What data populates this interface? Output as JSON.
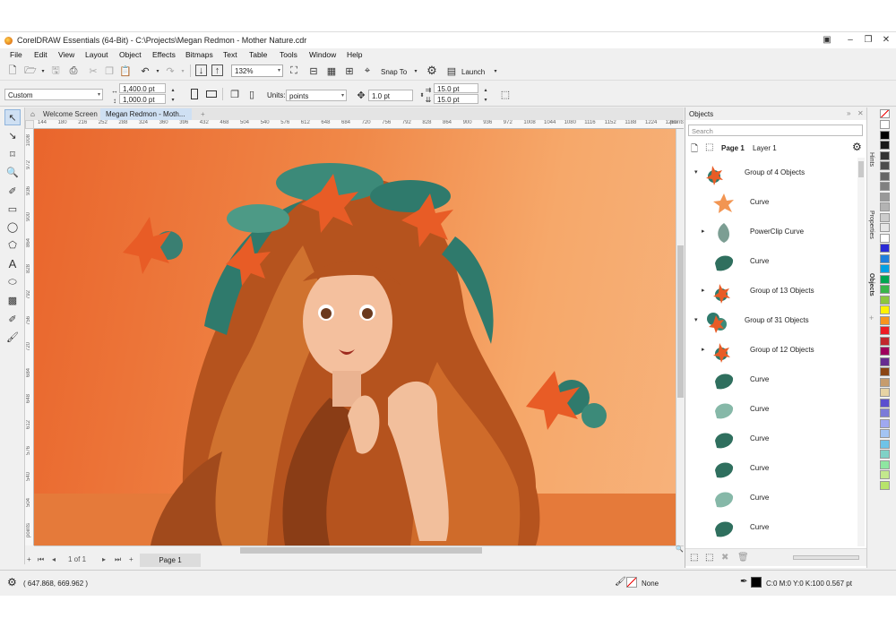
{
  "window": {
    "title": "CorelDRAW Essentials (64-Bit) - C:\\Projects\\Megan Redmon - Mother Nature.cdr"
  },
  "menu": [
    "File",
    "Edit",
    "View",
    "Layout",
    "Object",
    "Effects",
    "Bitmaps",
    "Text",
    "Table",
    "Tools",
    "Window",
    "Help"
  ],
  "toolbar": {
    "zoom_value": "132%",
    "snap_label": "Snap To",
    "launch_label": "Launch"
  },
  "property_bar": {
    "page_preset": "Custom",
    "width": "1,400.0 pt",
    "height": "1,000.0 pt",
    "units_label": "Units:",
    "units_value": "points",
    "nudge": "1.0 pt",
    "dup_x": "15.0 pt",
    "dup_y": "15.0 pt"
  },
  "tabs": {
    "welcome": "Welcome Screen",
    "document": "Megan Redmon - Moth..."
  },
  "ruler": {
    "h_ticks": [
      "144",
      "180",
      "216",
      "252",
      "288",
      "324",
      "360",
      "396",
      "432",
      "468",
      "504",
      "540",
      "576",
      "612",
      "648",
      "684",
      "720",
      "756",
      "792",
      "828",
      "864",
      "900",
      "936",
      "972",
      "1008",
      "1044",
      "1080",
      "1116",
      "1152",
      "1188",
      "1224",
      "1260"
    ],
    "h_unit": "points",
    "v_ticks": [
      "1008",
      "972",
      "936",
      "900",
      "864",
      "828",
      "792",
      "756",
      "720",
      "684",
      "648",
      "612",
      "576",
      "540",
      "504"
    ],
    "v_unit": "points"
  },
  "page_nav": {
    "counter": "1 of 1",
    "page_tab": "Page 1"
  },
  "objects_docker": {
    "title": "Objects",
    "search_placeholder": "Search",
    "page_label": "Page 1",
    "layer_label": "Layer 1",
    "rows": [
      {
        "label": "Group of 4 Objects",
        "twisty": "▾",
        "indent": 0,
        "thumb": "flower"
      },
      {
        "label": "Curve",
        "twisty": "",
        "indent": 1,
        "thumb": "orange-star"
      },
      {
        "label": "PowerClip Curve",
        "twisty": "▸",
        "indent": 1,
        "thumb": "gray-leaf"
      },
      {
        "label": "Curve",
        "twisty": "",
        "indent": 1,
        "thumb": "teal-leaf"
      },
      {
        "label": "Group of 13 Objects",
        "twisty": "▸",
        "indent": 1,
        "thumb": "flower"
      },
      {
        "label": "Group of 31 Objects",
        "twisty": "▾",
        "indent": 0,
        "thumb": "bouquet"
      },
      {
        "label": "Group of 12 Objects",
        "twisty": "▸",
        "indent": 1,
        "thumb": "flower"
      },
      {
        "label": "Curve",
        "twisty": "",
        "indent": 1,
        "thumb": "teal-leaf"
      },
      {
        "label": "Curve",
        "twisty": "",
        "indent": 1,
        "thumb": "light-leaf"
      },
      {
        "label": "Curve",
        "twisty": "",
        "indent": 1,
        "thumb": "teal-leaf"
      },
      {
        "label": "Curve",
        "twisty": "",
        "indent": 1,
        "thumb": "teal-leaf"
      },
      {
        "label": "Curve",
        "twisty": "",
        "indent": 1,
        "thumb": "light-leaf"
      },
      {
        "label": "Curve",
        "twisty": "",
        "indent": 1,
        "thumb": "teal-leaf"
      }
    ]
  },
  "side_tabs": [
    "Hints",
    "Properties",
    "Objects"
  ],
  "palette": [
    "#ffffff",
    "#000000",
    "#1a1a1a",
    "#333333",
    "#4d4d4d",
    "#666666",
    "#808080",
    "#999999",
    "#b3b3b3",
    "#cccccc",
    "#e6e6e6",
    "#ffffff",
    "#2b2bd6",
    "#1f7fdc",
    "#00a0e3",
    "#00a651",
    "#39b54a",
    "#8dc63f",
    "#fff200",
    "#f7941d",
    "#ed1c24",
    "#c1272d",
    "#9e005d",
    "#662d91",
    "#8b4513",
    "#c69c6d",
    "#e6d3a3",
    "#5a4fcf",
    "#7b7bd8",
    "#9fa8f0",
    "#a3c4f3",
    "#6fc3e7",
    "#7fd1c6",
    "#8ee6a1",
    "#c3e88d",
    "#b7e36b"
  ],
  "status": {
    "coordinates": "( 647.868, 669.962 )",
    "fill_label": "None",
    "outline_label": "C:0 M:0 Y:0 K:100  0.567 pt"
  }
}
